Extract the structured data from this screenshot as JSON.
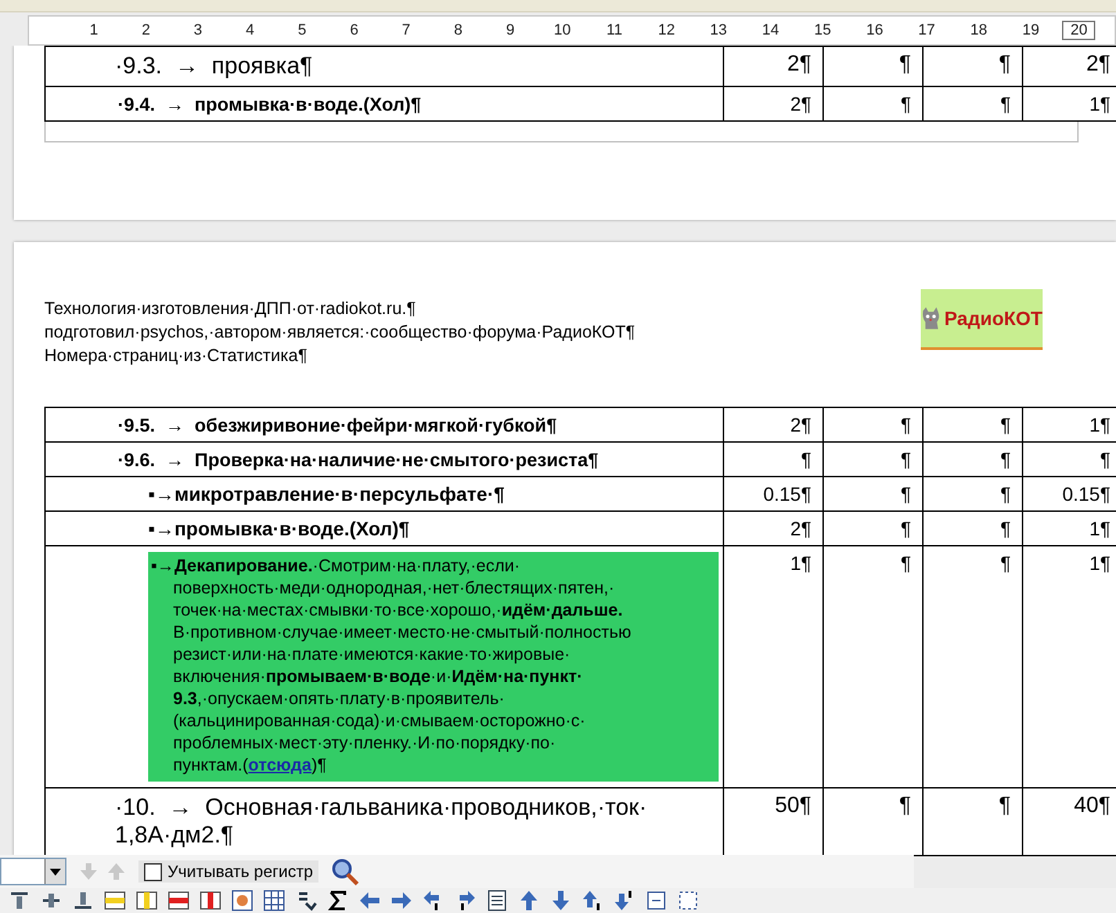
{
  "ruler": {
    "numbers": [
      "1",
      "2",
      "3",
      "4",
      "5",
      "6",
      "7",
      "8",
      "9",
      "10",
      "11",
      "12",
      "13",
      "14",
      "15",
      "16",
      "17",
      "18",
      "19",
      "20"
    ]
  },
  "page_1": {
    "rows": [
      {
        "kind": "heading",
        "text": "·9.3.  →  проявка¶",
        "cells": [
          "2¶",
          "¶",
          "¶",
          "2¶"
        ]
      },
      {
        "kind": "step",
        "text": "·9.4.  →  промывка·в·воде.(Хол)¶",
        "cells": [
          "2¶",
          "¶",
          "¶",
          "1¶"
        ]
      }
    ]
  },
  "page_2": {
    "header_lines": [
      "Технология·изготовления·ДПП·от·radiokot.ru.¶",
      "подготовил·psychos,·автором·является:·сообщество·форума·РадиоКОТ¶",
      "Номера·страниц·из·Статистика¶"
    ],
    "logo": {
      "text": "РадиоКОТ"
    },
    "rows": [
      {
        "kind": "step",
        "text": "·9.5.  →  обезжиривоние·фейри·мягкой·губкой¶",
        "cells": [
          "2¶",
          "¶",
          "¶",
          "1¶"
        ]
      },
      {
        "kind": "step",
        "text": "·9.6.  →  Проверка·на·наличие·не·смытого·резиста¶",
        "cells": [
          "¶",
          "¶",
          "¶",
          "¶"
        ]
      },
      {
        "kind": "bullet",
        "text": "▪→микротравление·в·персульфате·¶",
        "cells": [
          "0.15¶",
          "¶",
          "¶",
          "0.15¶"
        ]
      },
      {
        "kind": "bullet",
        "text": "▪→промывка·в·воде.(Хол)¶",
        "cells": [
          "2¶",
          "¶",
          "¶",
          "1¶"
        ]
      },
      {
        "kind": "note",
        "text": "▪→**Декапирование.**·Смотрим·на·плату,·если·\nповерхность·меди·однородная,·нет·блестящих·пятен,·\nточек·на·местах·смывки·то·все·хорошо,·**идём·дальше.**\nВ·противном·случае·имеет·место·не·смытый·полностью\nрезист·или·на·плате·имеются·какие·то·жировые·\nвключения·**промываем·в·воде**·и·**Идём·на·пункт·**\n**9.3**,·опускаем·опять·плату·в·проявитель·\n(кальцинированная·сода)·и·смываем·осторожно·с·\nпроблемных·мест·эту·пленку.·И·по·порядку·по·\nпунктам.(",
        "link": "отсюда",
        "text_after": ")¶",
        "cells": [
          "1¶",
          "¶",
          "¶",
          "1¶"
        ]
      },
      {
        "kind": "heading",
        "text": "·10.  →  Основная·гальваника·проводников,·ток· 1,8А·дм2.¶",
        "cells": [
          "50¶",
          "¶",
          "¶",
          "40¶"
        ]
      }
    ]
  },
  "find_toolbar": {
    "nav_buttons": [
      {
        "disabled": true
      },
      {
        "disabled": true
      }
    ],
    "match_case": {
      "label": "Учитывать регистр",
      "checked": false
    }
  }
}
